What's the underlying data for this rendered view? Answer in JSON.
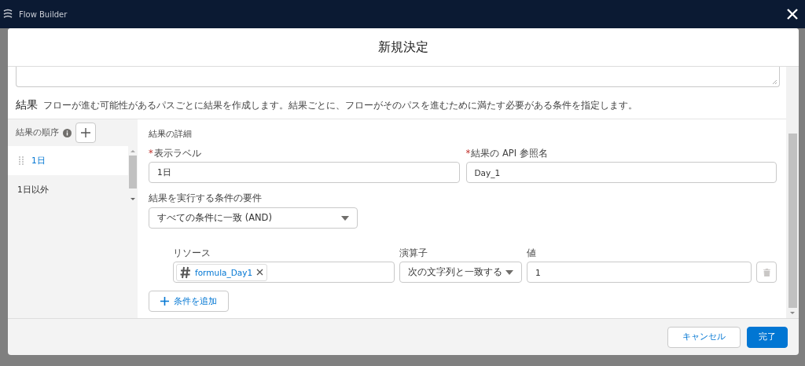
{
  "app_bar": {
    "title": "Flow Builder"
  },
  "dialog": {
    "title": "新規決定"
  },
  "section": {
    "heading": "結果",
    "description": "フローが進む可能性があるパスごとに結果を作成します。結果ごとに、フローがそのパスを進むために満たす必要がある条件を指定します。"
  },
  "outcome_order": {
    "label": "結果の順序",
    "items": [
      {
        "label": "1日",
        "selected": true
      },
      {
        "label": "1日以外",
        "selected": false
      }
    ]
  },
  "details": {
    "heading": "結果の詳細",
    "fields": [
      {
        "required_marker": "*",
        "label": "表示ラベル",
        "value": "1日"
      },
      {
        "required_marker": "*",
        "label": "結果の API 参照名",
        "value": "Day_1"
      }
    ],
    "condition_requirement": {
      "label": "結果を実行する条件の要件",
      "value": "すべての条件に一致 (AND)"
    },
    "condition_headers": {
      "resource": "リソース",
      "operator": "演算子",
      "value": "値"
    },
    "conditions": [
      {
        "resource": "formula_Day1",
        "operator": "次の文字列と一致する",
        "value": "1"
      }
    ],
    "add_condition": "条件を追加"
  },
  "buttons": [
    {
      "label": "キャンセル",
      "kind": "neutral"
    },
    {
      "label": "完了",
      "kind": "brand"
    }
  ]
}
